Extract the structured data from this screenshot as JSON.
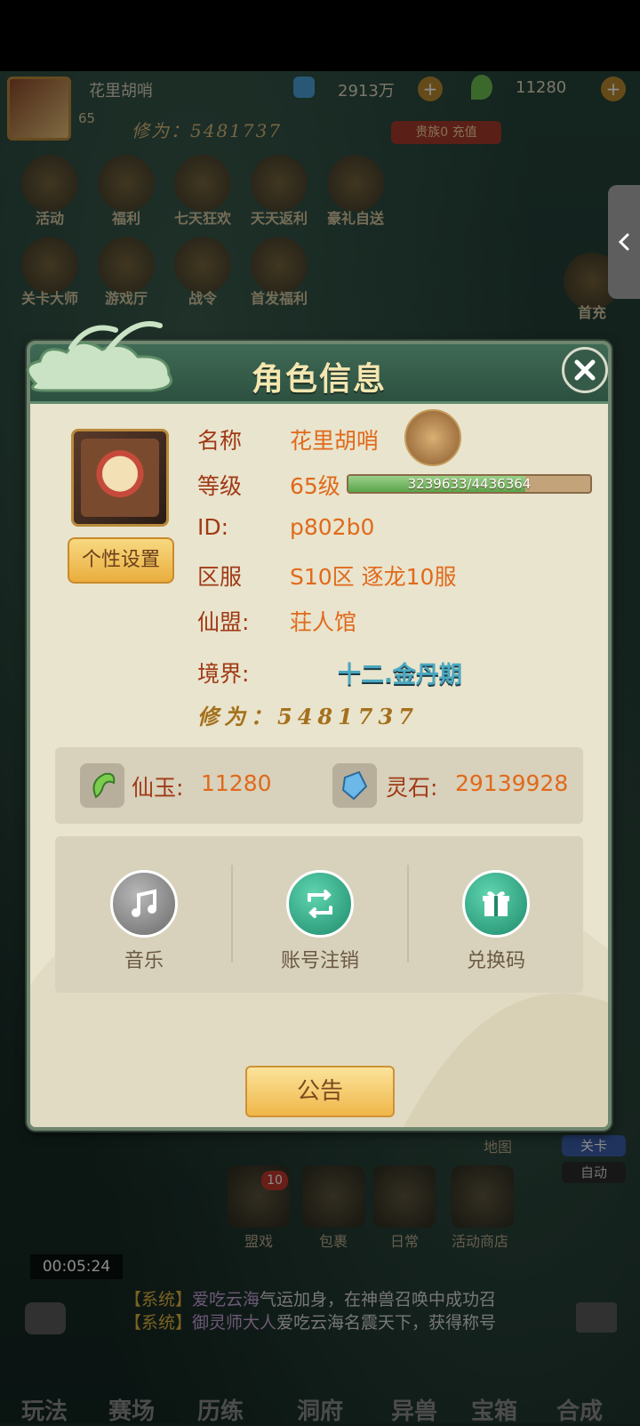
{
  "header": {
    "player_name": "花里胡哨",
    "level": "65",
    "xiuwei": "修为：5481737",
    "currency1": "2913万",
    "currency2": "11280",
    "recharge_label": "贵族0 充值"
  },
  "background_menu": {
    "row1": [
      "活动",
      "福利",
      "七天狂欢",
      "天天返利",
      "豪礼自送"
    ],
    "row2": [
      "关卡大师",
      "游戏厅",
      "战令",
      "首发福利"
    ],
    "right_label": "首充",
    "map_label": "地图",
    "guanka_label": "关卡",
    "auto_label": "自动"
  },
  "dialog": {
    "title": "角色信息",
    "custom_button": "个性设置",
    "fields": {
      "name_label": "名称",
      "name_value": "花里胡哨",
      "level_label": "等级",
      "level_value": "65级",
      "exp_text": "3239633/4436364",
      "exp_fraction": 0.73,
      "id_label": "ID:",
      "id_value": "p802b0",
      "server_label": "区服",
      "server_value": "S10区 逐龙10服",
      "guild_label": "仙盟:",
      "guild_value": "荘人馆",
      "realm_label": "境界:",
      "realm_value": "十二.金丹期",
      "xiuwei_text": "修为：5481737"
    },
    "currency": {
      "jade_label": "仙玉:",
      "jade_value": "11280",
      "stone_label": "灵石:",
      "stone_value": "29139928"
    },
    "settings": {
      "music_label": "音乐",
      "logout_label": "账号注销",
      "redeem_label": "兑换码"
    },
    "announce_button": "公告"
  },
  "lower": {
    "timer": "00:05:24",
    "icon_labels": [
      "盟戏",
      "包裹",
      "日常",
      "活动商店"
    ],
    "badge": "10",
    "chat": [
      {
        "tag": "【系统】",
        "name": "爱吃云海",
        "text": "气运加身，在神兽召唤中成功召"
      },
      {
        "tag": "【系统】",
        "name": "御灵师大人",
        "text": "爱吃云海名震天下，获得称号"
      }
    ],
    "nav": [
      "玩法",
      "赛场",
      "历练",
      "洞府",
      "异兽",
      "宝箱",
      "合成"
    ]
  },
  "colors": {
    "accent_orange": "#e06a1c",
    "label_red": "#a03a16",
    "dialog_bg": "#e9e4cd",
    "title_green": "#2d5040"
  }
}
